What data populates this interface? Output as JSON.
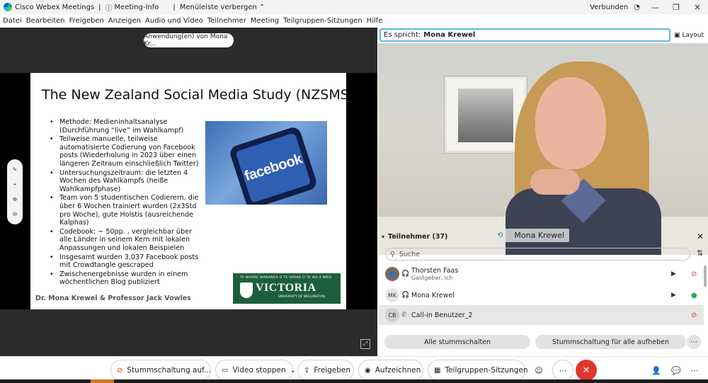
{
  "titlebar": {
    "app_name": "Cisco Webex Meetings",
    "meeting_info": "Meeting-Info",
    "hide_menu": "Menüleiste verbergen",
    "status": "Verbunden"
  },
  "menu": [
    "Datei",
    "Bearbeiten",
    "Freigeben",
    "Anzeigen",
    "Audio und Video",
    "Teilnehmer",
    "Meeting",
    "Teilgruppen-Sitzungen",
    "Hilfe"
  ],
  "share": {
    "pill": "Anwendung(en) von Mona Kr...",
    "slide": {
      "title": "The New Zealand Social Media Study (NZSMS)",
      "bullets": [
        "Methode: Medieninhaltsanalyse (Durchführung “live” im Wahlkampf)",
        "Teilweise manuelle, teilweise automatisierte Codierung von Facebook posts (Wiederholung in 2023 über einen längeren Zeitraum einschließlich Twitter)",
        "Untersuchungszeitraum: die letzten 4 Wochen des Wahlkampfs (heiße Wahlkampfphase)",
        "Team von 5 studentischen Codierern, die über 6 Wochen trainiert wurden (2x3Std pro Woche), gute Holstis (ausreichende Kalphas)",
        "Codebook: ~ 50pp. , vergleichbar über alle Länder in seinem Kern mit lokalen Anpassungen und lokalen Beispielen",
        "Insgesamt wurden 3,037 Facebook posts mit Crowdtangle gescraped",
        "Zwischenergebnisse wurden in einem wöchentlichen Blog publiziert"
      ],
      "image_word": "facebook",
      "footer": "Dr. Mona Krewel & Professor Jack Vowles",
      "logo_motto": "TE WHARE WĀNANGA O TE ŪPOKO O TE IKA A MĀUI",
      "logo_name": "VICTORIA",
      "logo_sub": "UNIVERSITY OF WELLINGTON"
    }
  },
  "right": {
    "speaking_label": "Es spricht:",
    "speaking_name": "Mona Krewel",
    "layout_label": "Layout",
    "video_name": "Mona Krewel",
    "participants_title": "Teilnehmer (37)",
    "search_placeholder": "Suche",
    "participants": [
      {
        "initials": "",
        "name": "Thorsten Faas",
        "role": "Gastgeber, ich"
      },
      {
        "initials": "MK",
        "name": "Mona Krewel",
        "role": ""
      },
      {
        "initials": "CB",
        "name": "Call-in Benutzer_2",
        "role": ""
      }
    ],
    "mute_all": "Alle stummschalten",
    "unmute_all": "Stummschaltung für alle aufheben"
  },
  "controls": {
    "mute": "Stummschaltung auf...",
    "video": "Video stoppen",
    "share": "Freigeben",
    "record": "Aufzeichnen",
    "breakout": "Teilgruppen-Sitzungen"
  },
  "colors": {
    "end_button": "#e0362e",
    "speaking_border": "#5db8e6",
    "victoria_green": "#1d5e3a"
  }
}
